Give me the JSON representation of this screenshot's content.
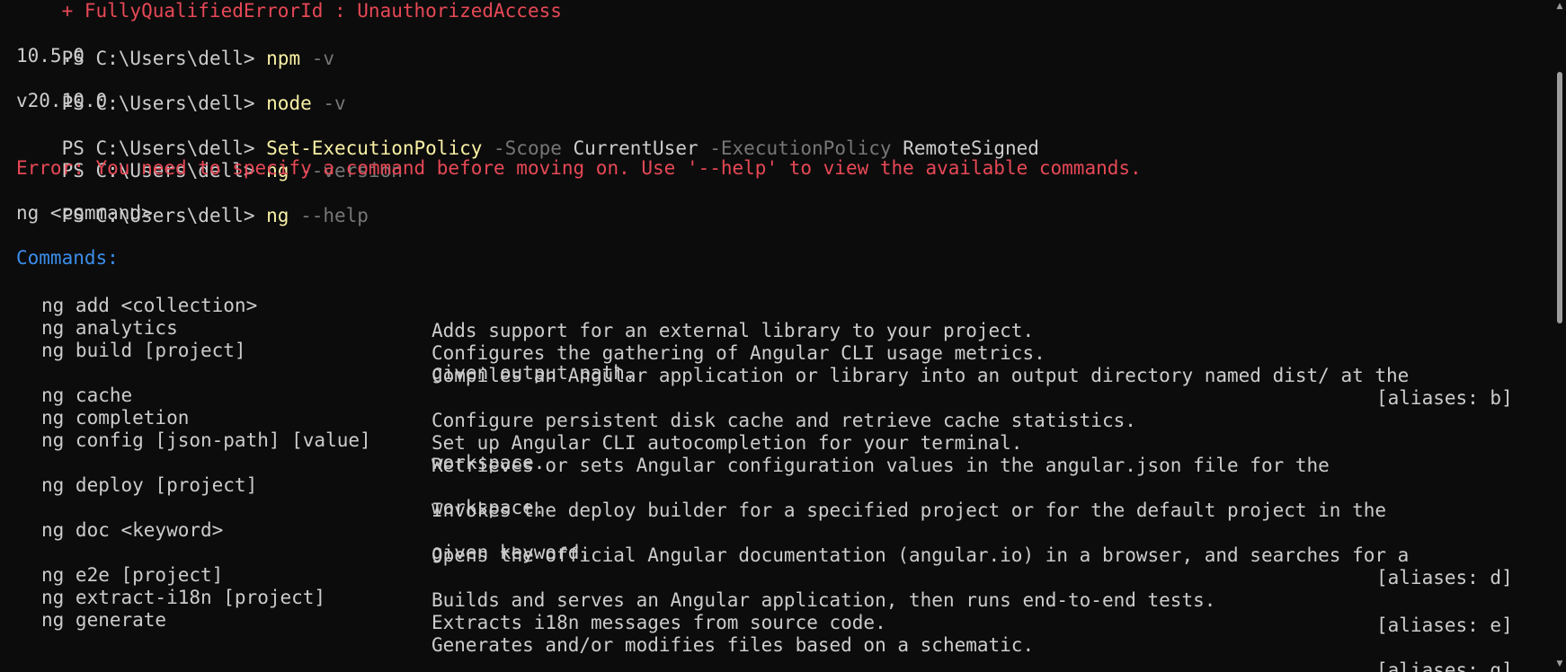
{
  "colors": {
    "background": "#0c0c0c",
    "text": "#cccccc",
    "command": "#f9f1a5",
    "parameter": "#767676",
    "error": "#e74856",
    "heading": "#3b8eea"
  },
  "terminal": {
    "error_id_line": "    + FullyQualifiedErrorId : UnauthorizedAccess",
    "prompt": "PS C:\\Users\\dell> ",
    "history": [
      {
        "command": "npm",
        "args": " -v",
        "output": "10.5.0"
      },
      {
        "command": "node",
        "args": " -v",
        "output": "v20.10.0"
      },
      {
        "command": "Set-ExecutionPolicy",
        "param1": " -Scope",
        "value1": " CurrentUser",
        "param2": " -ExecutionPolicy",
        "value2": " RemoteSigned"
      },
      {
        "command": "ng",
        "args": " --version",
        "error": "Error: You need to specify a command before moving on. Use '--help' to view the available commands."
      },
      {
        "command": "ng",
        "args": " --help",
        "output": "ng <command>"
      }
    ],
    "commands_heading": "Commands:",
    "help_rows": [
      {
        "cmd": "ng add <collection>",
        "desc": "Adds support for an external library to your project.",
        "desc2": "",
        "alias": ""
      },
      {
        "cmd": "ng analytics",
        "desc": "Configures the gathering of Angular CLI usage metrics.",
        "desc2": "",
        "alias": ""
      },
      {
        "cmd": "ng build [project]",
        "desc": "Compiles an Angular application or library into an output directory named dist/ at the",
        "desc2": "given output path.",
        "alias": "[aliases: b]"
      },
      {
        "cmd": "ng cache",
        "desc": "Configure persistent disk cache and retrieve cache statistics.",
        "desc2": "",
        "alias": ""
      },
      {
        "cmd": "ng completion",
        "desc": "Set up Angular CLI autocompletion for your terminal.",
        "desc2": "",
        "alias": ""
      },
      {
        "cmd": "ng config [json-path] [value]",
        "desc": "Retrieves or sets Angular configuration values in the angular.json file for the",
        "desc2": "workspace.",
        "alias": ""
      },
      {
        "cmd": "ng deploy [project]",
        "desc": "Invokes the deploy builder for a specified project or for the default project in the",
        "desc2": "workspace.",
        "alias": ""
      },
      {
        "cmd": "ng doc <keyword>",
        "desc": "Opens the official Angular documentation (angular.io) in a browser, and searches for a",
        "desc2": "given keyword.",
        "alias": "[aliases: d]"
      },
      {
        "cmd": "ng e2e [project]",
        "desc": "Builds and serves an Angular application, then runs end-to-end tests.",
        "desc2": "",
        "alias": "[aliases: e]"
      },
      {
        "cmd": "ng extract-i18n [project]",
        "desc": "Extracts i18n messages from source code.",
        "desc2": "",
        "alias": ""
      },
      {
        "cmd": "ng generate",
        "desc": "Generates and/or modifies files based on a schematic.",
        "desc2": "",
        "alias": "[aliases: g]"
      }
    ]
  },
  "scrollbar": {
    "up_icon": "scroll-up-arrow-icon",
    "down_icon": "scroll-down-arrow-icon"
  }
}
